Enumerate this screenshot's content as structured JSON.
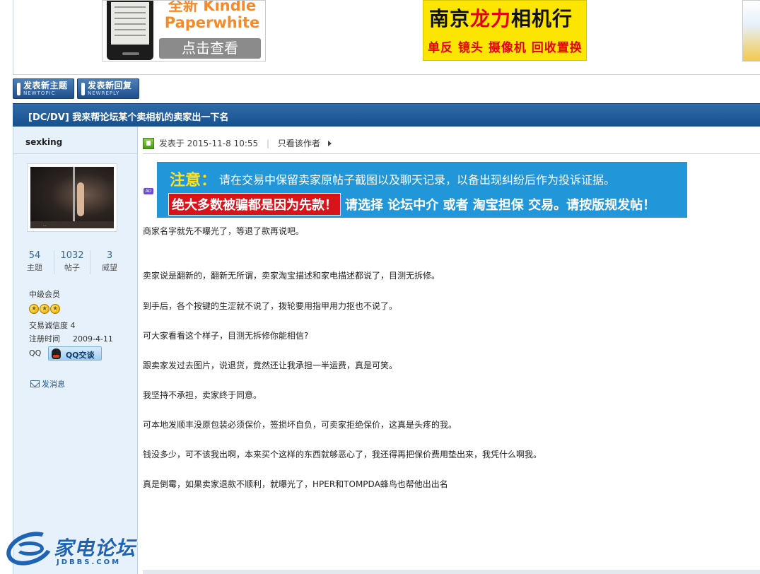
{
  "ads": {
    "kindle_title": "全新 Kindle Paperwhite",
    "kindle_button": "点击查看",
    "camera_store_a": "南京",
    "camera_store_b": "龙力",
    "camera_store_c": "相机行",
    "camera_tagline": "单反 镜头 摄像机 回收置换"
  },
  "toolbar": {
    "new_topic_label": "发表新主题",
    "new_topic_sub": "NEWTOPIC",
    "new_reply_label": "发表新回复",
    "new_reply_sub": "NEWREPLY"
  },
  "thread": {
    "title": "[DC/DV] 我来帮论坛某个卖相机的卖家出一下名"
  },
  "user": {
    "name": "sexking",
    "avatar_caption": "...",
    "stats": [
      {
        "value": "54",
        "label": "主题"
      },
      {
        "value": "1032",
        "label": "帖子"
      },
      {
        "value": "3",
        "label": "威望"
      }
    ],
    "group": "中级会员",
    "stars": 3,
    "trust": "交易诚信度 4",
    "reg_label": "注册时间",
    "reg_date": "2009-4-11",
    "qq_label": "QQ",
    "qq_button": "QQ交谈",
    "send_message": "发消息"
  },
  "post": {
    "posted_at": "发表于 2015-11-8 10:55",
    "separator": "|",
    "only_author": "只看该作者",
    "ad_badge": "AD",
    "notice_head": "注意：",
    "notice_text": "请在交易中保留卖家原帖子截图以及聊天记录，以备出现纠纷后作为投诉证据。",
    "notice_red": "绝大多数被骗都是因为先款！",
    "notice_rest": "请选择 论坛中介 或者 淘宝担保 交易。请按版规发帖！",
    "paragraphs": [
      "商家名字就先不曝光了，等退了款再说吧。",
      "卖家说是翻新的，翻新无所谓，卖家淘宝描述和家电描述都说了，目测无拆修。",
      "到手后，各个按键的生涩就不说了，拨轮要用指甲用力抠也不说了。",
      "可大家看看这个样子，目测无拆修你能相信?",
      "跟卖家发过去图片，说退货，竟然还让我承担一半运费，真是可笑。",
      "我坚持不承担，卖家终于同意。",
      "可本地发顺丰没原包装必须保价，签损坏自负，可卖家拒绝保价，这真是头疼的我。",
      "钱没多少，可不该我出啊，本来买个这样的东西就够恶心了，我还得再把保价费用垫出来，我凭什么啊我。",
      "真是倒霉，如果卖家退款不顺利，就曝光了，HPER和TOMPDA蜂鸟也帮他出出名"
    ]
  },
  "watermark": {
    "name": "家电论坛",
    "domain": "JDBBS.COM"
  },
  "colors": {
    "header_blue": "#17508f",
    "sidebar_bg": "#e7f1fb",
    "notice_blue": "#2196d8",
    "notice_red": "#d8141a",
    "notice_yellow": "#ffe01a",
    "star_gold": "#f4c21b",
    "link_blue": "#225588"
  }
}
